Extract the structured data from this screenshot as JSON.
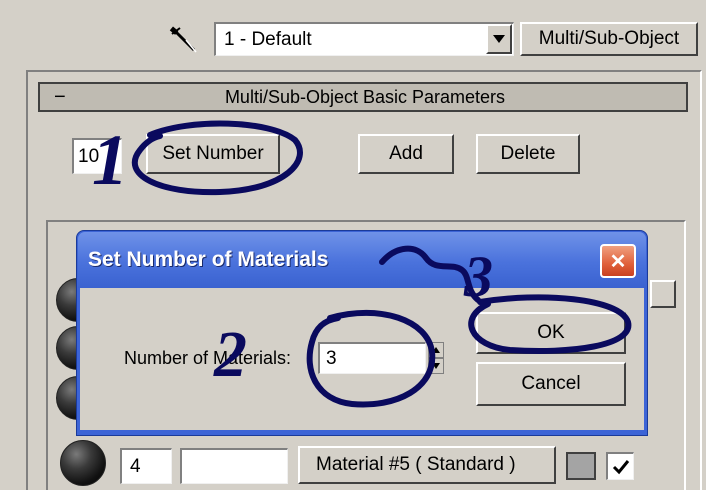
{
  "toolbar": {
    "picker_icon": "eyedropper-icon",
    "material_name": "1 - Default",
    "material_type": "Multi/Sub-Object"
  },
  "rollout": {
    "collapse_symbol": "−",
    "title": "Multi/Sub-Object Basic Parameters",
    "count_value": "10",
    "set_number_label": "Set Number",
    "add_label": "Add",
    "delete_label": "Delete"
  },
  "material_row": {
    "id": "4",
    "name": "",
    "material_label": "Material #5  ( Standard )",
    "enabled": true
  },
  "dialog": {
    "title": "Set Number of Materials",
    "close_symbol": "✕",
    "field_label": "Number of Materials:",
    "field_value": "3",
    "ok_label": "OK",
    "cancel_label": "Cancel"
  },
  "annotations": {
    "step1": "1",
    "step2": "2",
    "step3": "3",
    "ink_color": "#0a0a5e"
  }
}
